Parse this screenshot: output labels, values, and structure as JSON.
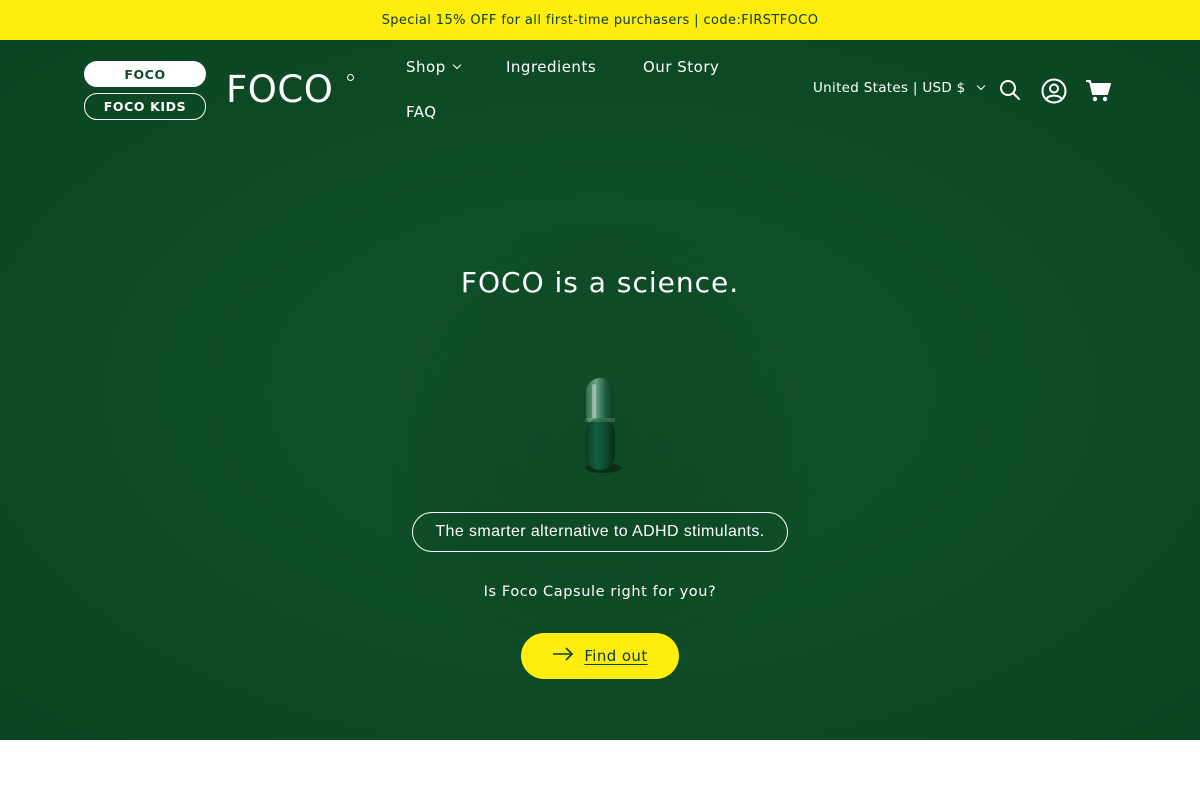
{
  "announcement": {
    "text": "Special 15% OFF for all first-time purchasers | code:FIRSTFOCO"
  },
  "header": {
    "brand_toggles": [
      "FOCO",
      "FOCO KIDS"
    ],
    "logo_text": "FOCO",
    "nav": [
      {
        "label": "Shop",
        "has_dropdown": true
      },
      {
        "label": "Ingredients"
      },
      {
        "label": "Our Story"
      },
      {
        "label": "FAQ"
      }
    ],
    "locale": "United States | USD $",
    "icons": [
      "search-icon",
      "account-icon",
      "cart-icon"
    ]
  },
  "hero": {
    "title": "FOCO is a science.",
    "tagline": "The smarter alternative to ADHD stimulants.",
    "question": "Is Foco Capsule right for you?",
    "cta_label": "Find out"
  },
  "colors": {
    "accent_yellow": "#ffed0f",
    "hero_green": "#0d4c26",
    "text_white": "#ffffff"
  }
}
